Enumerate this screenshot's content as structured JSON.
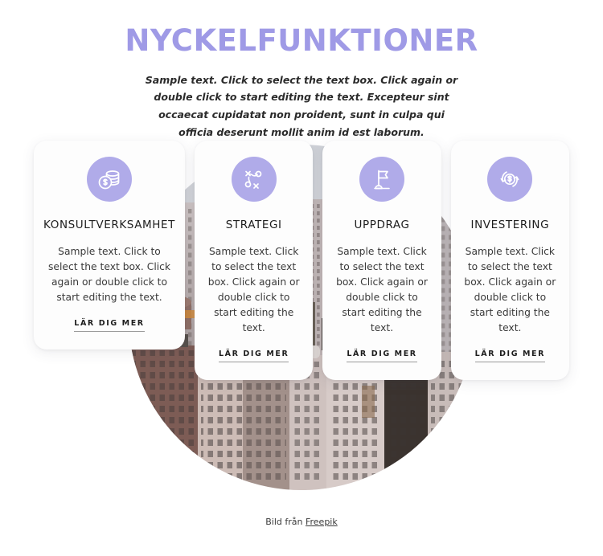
{
  "header": {
    "title": "NYCKELFUNKTIONER",
    "subtitle": "Sample text. Click to select the text box. Click again or double click to start editing the text. Excepteur sint occaecat cupidatat non proident, sunt in culpa qui officia deserunt mollit anim id est laborum.",
    "title_color": "#9f9ae6"
  },
  "background": {
    "shape": "circle",
    "image_name": "cityscape-photo",
    "alt": "City skyline with apartment and office buildings"
  },
  "cards": [
    {
      "icon": "coins-stack-dollar-icon",
      "title": "KONSULTVERKSAMHET",
      "text": "Sample text. Click to select the text box. Click again or double click to start editing the text.",
      "link_label": "LÄR DIG MER"
    },
    {
      "icon": "strategy-playbook-icon",
      "title": "STRATEGI",
      "text": "Sample text. Click to select the text box. Click again or double click to start editing the text.",
      "link_label": "LÄR DIG MER"
    },
    {
      "icon": "flag-icon",
      "title": "UPPDRAG",
      "text": "Sample text. Click to select the text box. Click again or double click to start editing the text.",
      "link_label": "LÄR DIG MER"
    },
    {
      "icon": "currency-exchange-dollar-icon",
      "title": "INVESTERING",
      "text": "Sample text. Click to select the text box. Click again or double click to start editing the text.",
      "link_label": "LÄR DIG MER"
    }
  ],
  "footer": {
    "credit_prefix": "Bild från ",
    "credit_link": "Freepik"
  },
  "colors": {
    "accent": "#b0abe9",
    "title": "#9f9ae6",
    "card_background": "#fdfdfd",
    "text": "#1d1d1d"
  }
}
